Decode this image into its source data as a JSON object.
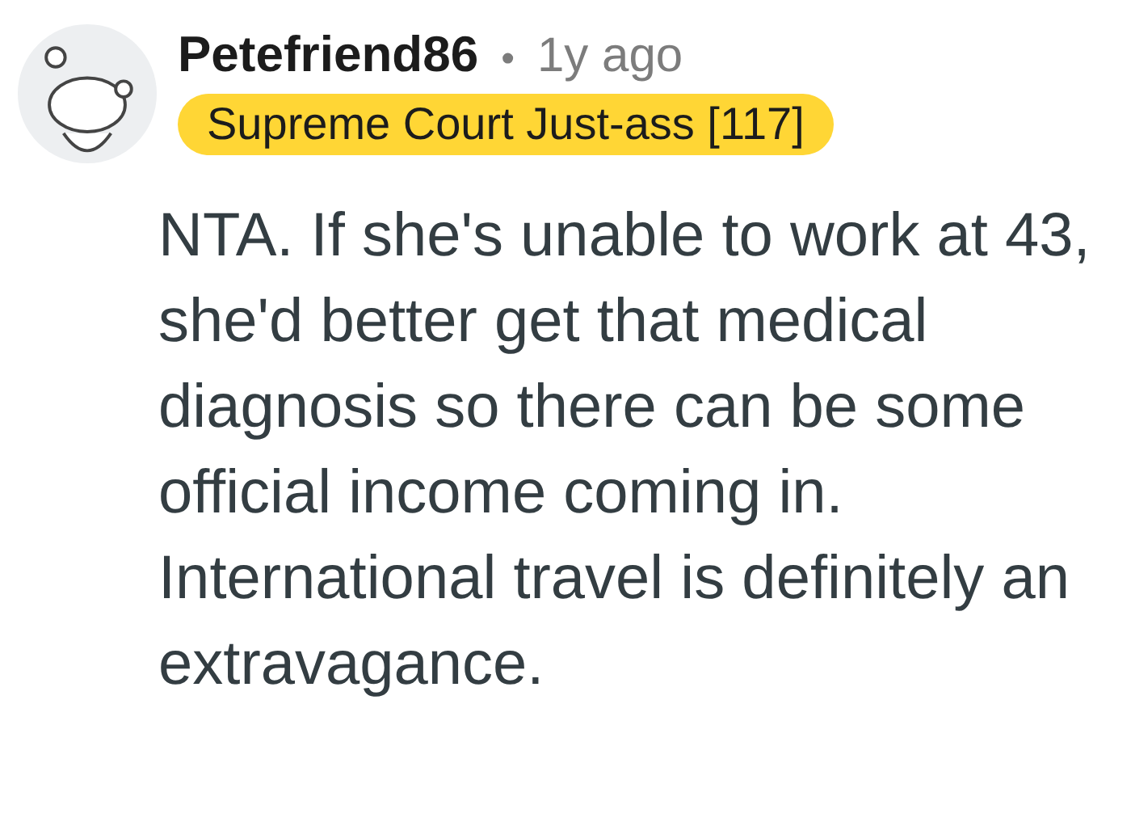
{
  "comment": {
    "author": "Petefriend86",
    "separator": "•",
    "age": "1y ago",
    "flair": "Supreme Court Just-ass [117]",
    "body": "NTA. If she's unable to work at 43, she'd better get that medical diagnosis so there can be some official income coming in. International travel is definitely an extravagance."
  }
}
